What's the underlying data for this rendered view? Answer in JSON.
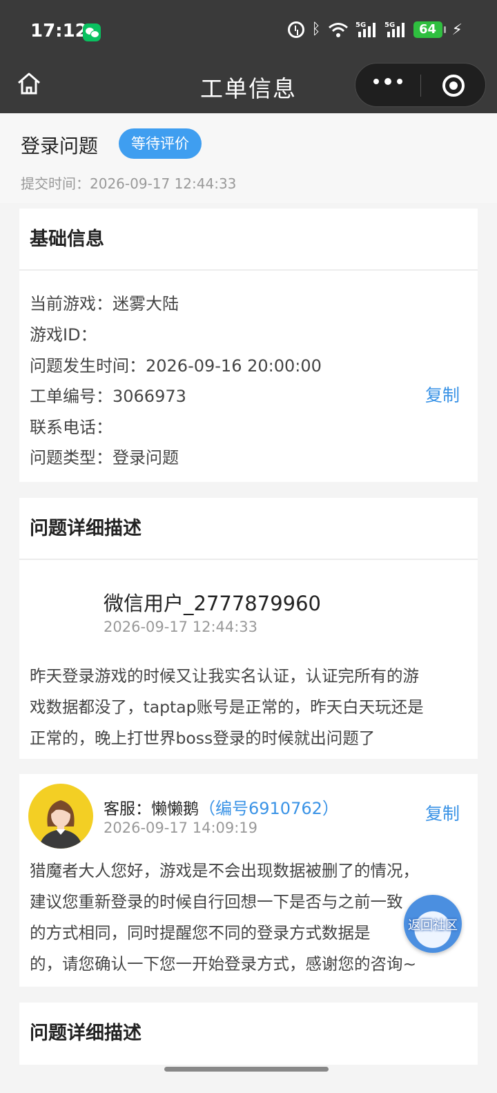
{
  "status_bar": {
    "time": "17:12",
    "battery": "64",
    "network": "5G"
  },
  "nav": {
    "title": "工单信息"
  },
  "ticket": {
    "title": "登录问题",
    "status": "等待评价",
    "submit_time": "提交时间：2026-09-17 12:44:33"
  },
  "basic_info": {
    "heading": "基础信息",
    "rows": [
      "当前游戏：迷雾大陆",
      "游戏ID：",
      "问题发生时间：2026-09-16 20:00:00",
      "工单编号：3066973",
      "联系电话：",
      "问题类型：登录问题"
    ],
    "copy_label": "复制"
  },
  "detail": {
    "heading": "问题详细描述",
    "user_name": "微信用户_2777879960",
    "time": "2026-09-17 12:44:33",
    "lines": [
      "昨天登录游戏的时候又让我实名认证，认证完所有的游",
      "戏数据都没了，taptap账号是正常的，昨天白天玩还是",
      "正常的，晚上打世界boss登录的时候就出问题了"
    ]
  },
  "reply": {
    "agent_label": "客服：懒懒鹅",
    "agent_id": "（编号6910762）",
    "copy_label": "复制",
    "time": "2026-09-17 14:09:19",
    "lines": [
      "猎魔者大人您好，游戏是不会出现数据被删了的情况，",
      "建议您重新登录的时候自行回想一下是否与之前一致",
      "的方式相同，同时提醒您不同的登录方式数据是",
      "的，请您确认一下您一开始登录方式，感谢您的咨询~"
    ]
  },
  "detail2": {
    "heading": "问题详细描述"
  },
  "float_button": {
    "label": "返回社区"
  }
}
